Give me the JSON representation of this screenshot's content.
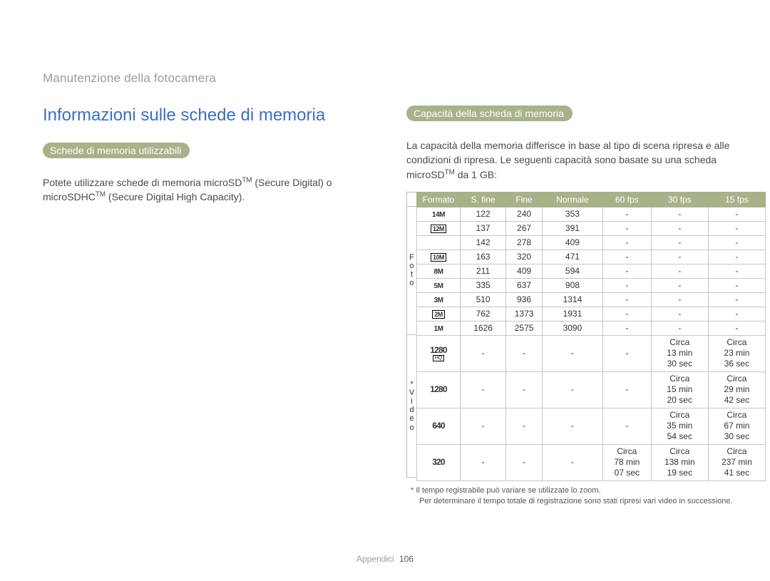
{
  "breadcrumb": "Manutenzione della fotocamera",
  "h1": "Informazioni sulle schede di memoria",
  "left": {
    "pill": "Schede di memoria utilizzabili",
    "text_1": "Potete utilizzare schede di memoria microSD",
    "tm1": "TM",
    "text_2": " (Secure Digital) o microSDHC",
    "tm2": "TM",
    "text_3": " (Secure Digital High Capacity)."
  },
  "right": {
    "pill": "Capacità della scheda di memoria",
    "intro_1": "La capacità della memoria differisce in base al tipo di scena ripresa e alle condizioni di ripresa. Le seguenti capacità sono basate su una scheda microSD",
    "intro_tm": "TM",
    "intro_2": " da 1 GB:"
  },
  "vlabels": {
    "foto": "Foto",
    "video": "* Video"
  },
  "table": {
    "headers": [
      "Formato",
      "S. fine",
      "Fine",
      "Normale",
      "60 fps",
      "30 fps",
      "15 fps"
    ],
    "foto_rows": [
      {
        "icon": "14M",
        "style": "plain",
        "cells": [
          "122",
          "240",
          "353",
          "-",
          "-",
          "-"
        ]
      },
      {
        "icon": "12M",
        "style": "box",
        "cells": [
          "137",
          "267",
          "391",
          "-",
          "-",
          "-"
        ]
      },
      {
        "icon": "",
        "style": "blank",
        "cells": [
          "142",
          "278",
          "409",
          "-",
          "-",
          "-"
        ]
      },
      {
        "icon": "10M",
        "style": "box",
        "cells": [
          "163",
          "320",
          "471",
          "-",
          "-",
          "-"
        ]
      },
      {
        "icon": "8M",
        "style": "plain",
        "cells": [
          "211",
          "409",
          "594",
          "-",
          "-",
          "-"
        ]
      },
      {
        "icon": "5M",
        "style": "plain",
        "cells": [
          "335",
          "637",
          "908",
          "-",
          "-",
          "-"
        ]
      },
      {
        "icon": "3M",
        "style": "plain",
        "cells": [
          "510",
          "936",
          "1314",
          "-",
          "-",
          "-"
        ]
      },
      {
        "icon": "2M",
        "style": "box",
        "cells": [
          "762",
          "1373",
          "1931",
          "-",
          "-",
          "-"
        ]
      },
      {
        "icon": "1M",
        "style": "plain",
        "cells": [
          "1626",
          "2575",
          "3090",
          "-",
          "-",
          "-"
        ]
      }
    ],
    "video_rows": [
      {
        "icon": "1280",
        "hq": true,
        "cells": [
          "-",
          "-",
          "-",
          "-",
          "Circa\n13 min\n30 sec",
          "Circa\n23 min\n36 sec"
        ]
      },
      {
        "icon": "1280",
        "hq": false,
        "cells": [
          "-",
          "-",
          "-",
          "-",
          "Circa\n15 min\n20 sec",
          "Circa\n29 min\n42 sec"
        ]
      },
      {
        "icon": "640",
        "hq": false,
        "cells": [
          "-",
          "-",
          "-",
          "-",
          "Circa\n35 min\n54 sec",
          "Circa\n67 min\n30 sec"
        ]
      },
      {
        "icon": "320",
        "hq": false,
        "cells": [
          "-",
          "-",
          "-",
          "Circa\n78 min\n07 sec",
          "Circa\n138 min\n19 sec",
          "Circa\n237 min\n41 sec"
        ]
      }
    ]
  },
  "footnotes": {
    "a": "* Il tempo registrabile può variare se utilizzate lo zoom.",
    "b": "Per determinare il tempo totale di registrazione sono stati ripresi vari video in successione."
  },
  "footer": {
    "section": "Appendici",
    "page": "106"
  }
}
